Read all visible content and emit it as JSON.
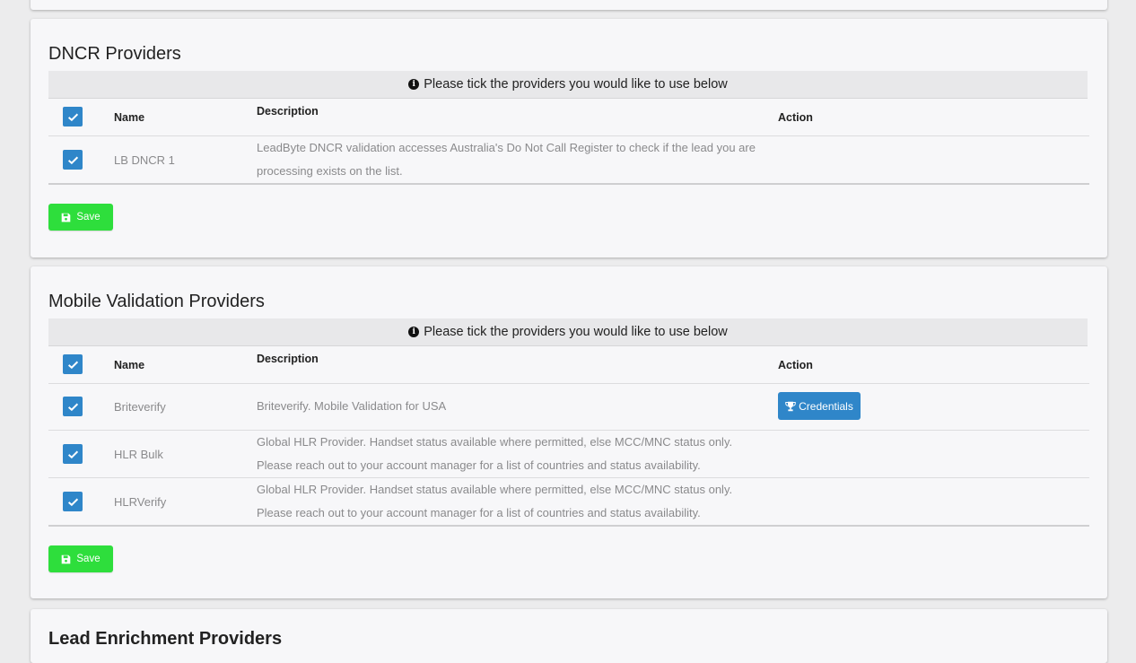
{
  "dncr": {
    "title": "DNCR Providers",
    "notice": "Please tick the providers you would like to use below",
    "headers": {
      "name": "Name",
      "description": "Description",
      "action": "Action"
    },
    "rows": [
      {
        "name": "LB DNCR 1",
        "desc1": "LeadByte DNCR validation accesses Australia's Do Not Call Register to check if the lead you are",
        "desc2": "processing exists on the list.",
        "checked": true
      }
    ],
    "save_label": "Save"
  },
  "mobile": {
    "title": "Mobile Validation Providers",
    "notice": "Please tick the providers you would like to use below",
    "headers": {
      "name": "Name",
      "description": "Description",
      "action": "Action"
    },
    "rows": [
      {
        "name": "Briteverify",
        "desc1": "Briteverify. Mobile Validation for USA",
        "action": "Credentials",
        "checked": true
      },
      {
        "name": "HLR Bulk",
        "desc1": "Global HLR Provider. Handset status available where permitted, else MCC/MNC status only.",
        "desc2": "Please reach out to your account manager for a list of countries and status availability.",
        "checked": true
      },
      {
        "name": "HLRVerify",
        "desc1": "Global HLR Provider. Handset status available where permitted, else MCC/MNC status only.",
        "desc2": "Please reach out to your account manager for a list of countries and status availability.",
        "checked": true
      }
    ],
    "save_label": "Save"
  },
  "lead_enrichment": {
    "title": "Lead Enrichment Providers"
  },
  "colors": {
    "accent": "#2f86c9",
    "save": "#2ede3c",
    "card": "#f7f7f9",
    "background": "#ececed"
  },
  "icons": {
    "info": "info-circle-icon",
    "check": "checkmark-icon",
    "save": "floppy-disk-icon",
    "credentials": "trophy-icon"
  }
}
